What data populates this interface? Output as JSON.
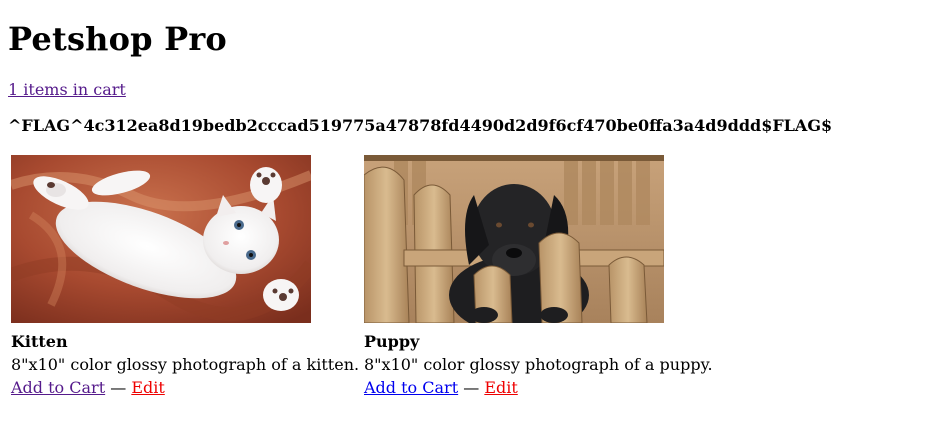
{
  "header": {
    "title": "Petshop Pro",
    "cart_link": "1 items in cart"
  },
  "flag_text": "^FLAG^4c312ea8d19bedb2cccad519775a47878fd4490d2d9f6cf470be0ffa3a4d9ddd$FLAG$",
  "products": [
    {
      "name": "Kitten",
      "description": "8\"x10\" color glossy photograph of a kitten.",
      "add_label": "Add to Cart",
      "separator": "—",
      "edit_label": "Edit"
    },
    {
      "name": "Puppy",
      "description": "8\"x10\" color glossy photograph of a puppy.",
      "add_label": "Add to Cart",
      "separator": "—",
      "edit_label": "Edit"
    }
  ],
  "colors": {
    "visited_link": "#551a8b",
    "link": "#0000ee",
    "edit_link": "#ee0000"
  }
}
